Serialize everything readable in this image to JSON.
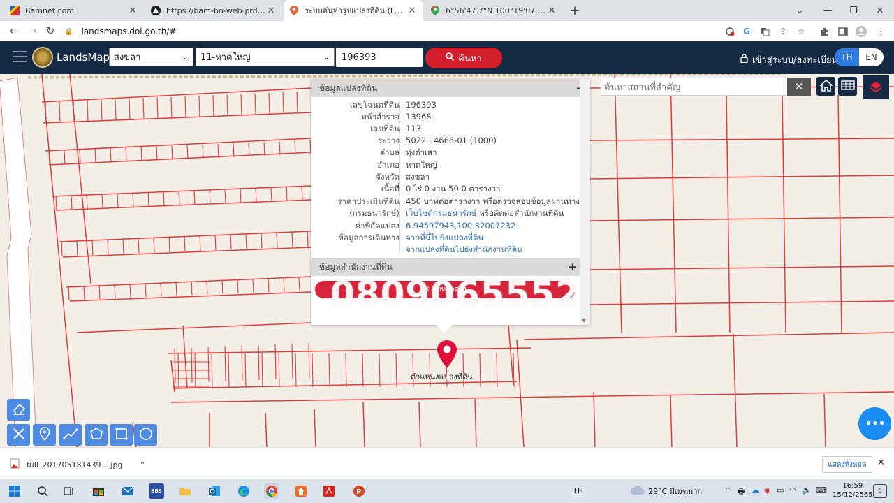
{
  "browser": {
    "tabs": [
      {
        "title": "Bamnet.com",
        "active": false
      },
      {
        "title": "https://bam-bo-web-prd.bam.co",
        "active": false
      },
      {
        "title": "ระบบค้นหารูปแปลงที่ดิน (LandsMaps",
        "active": true
      },
      {
        "title": "6°56'47.7\"N 100°19'07.7\"E - Goo",
        "active": false
      }
    ],
    "new_tab": "+",
    "url": "landsmaps.dol.go.th/#",
    "window_controls": {
      "collapse": "⌄",
      "minimize": "—",
      "maximize": "❐",
      "close": "✕"
    }
  },
  "header": {
    "brand": "LandsMaps",
    "province": "สงขลา",
    "district": "11-หาดใหญ่",
    "deed_number": "196393",
    "search_label": "ค้นหา",
    "login_label": "เข้าสู่ระบบ/ลงทะเบียน",
    "lang_th": "TH",
    "lang_en": "EN"
  },
  "panel": {
    "title": "ข้อมูลแปลงที่ดิน",
    "collapse_symbol": "−",
    "rows": [
      {
        "label": "เลขโฉนดที่ดิน",
        "value": "196393"
      },
      {
        "label": "หน้าสำรวจ",
        "value": "13968"
      },
      {
        "label": "เลขที่ดิน",
        "value": "113"
      },
      {
        "label": "ระวาง",
        "value": "5022 I 4666-01 (1000)"
      },
      {
        "label": "ตำบล",
        "value": "ทุ่งตำเสา"
      },
      {
        "label": "อำเภอ",
        "value": "หาดใหญ่"
      },
      {
        "label": "จังหวัด",
        "value": "สงขลา"
      },
      {
        "label": "เนื้อที่",
        "value": "0 ไร่ 0 งาน 50.0 ตารางวา"
      },
      {
        "label": "ราคาประเมินที่ดิน",
        "value": "450 บาทต่อตารางวา หรือตรวจสอบข้อมูลผ่านทาง"
      },
      {
        "label": "(กรมธนารักษ์)",
        "value_link": "เว็บไซต์กรมธนารักษ์",
        "value_rest": " หรือติดต่อสำนักงานที่ดิน"
      },
      {
        "label": "ค่าพิกัดแปลง",
        "value_link": "6.94597943,100.32007232"
      },
      {
        "label": "ข้อมูลการเดินทาง",
        "value_link": "จากที่นี่ไปยังแปลงที่ดิน"
      },
      {
        "label": "",
        "value_link": "จากแปลงที่ดินไปยังสำนักงานที่ดิน"
      }
    ],
    "office_title": "ข้อมูลสำนักงานที่ดิน",
    "expand_symbol": "+",
    "red_button": "✕ ปิดหน้าต่าง",
    "watermark": "0809065552"
  },
  "map": {
    "marker_label": "ตำแหน่งแปลงที่ดิน",
    "place_search_placeholder": "ค้นหาสถานที่สำคัญ",
    "clear_symbol": "✕"
  },
  "download_bar": {
    "file_name": "full_201705181439....jpg",
    "show_all": "แสดงทั้งหมด",
    "close": "✕"
  },
  "taskbar": {
    "lang": "TH",
    "weather": "29°C มีเมฆมาก",
    "time": "16:59",
    "date": "15/12/2565",
    "notification_count": "6",
    "store_badge": "BBS"
  }
}
